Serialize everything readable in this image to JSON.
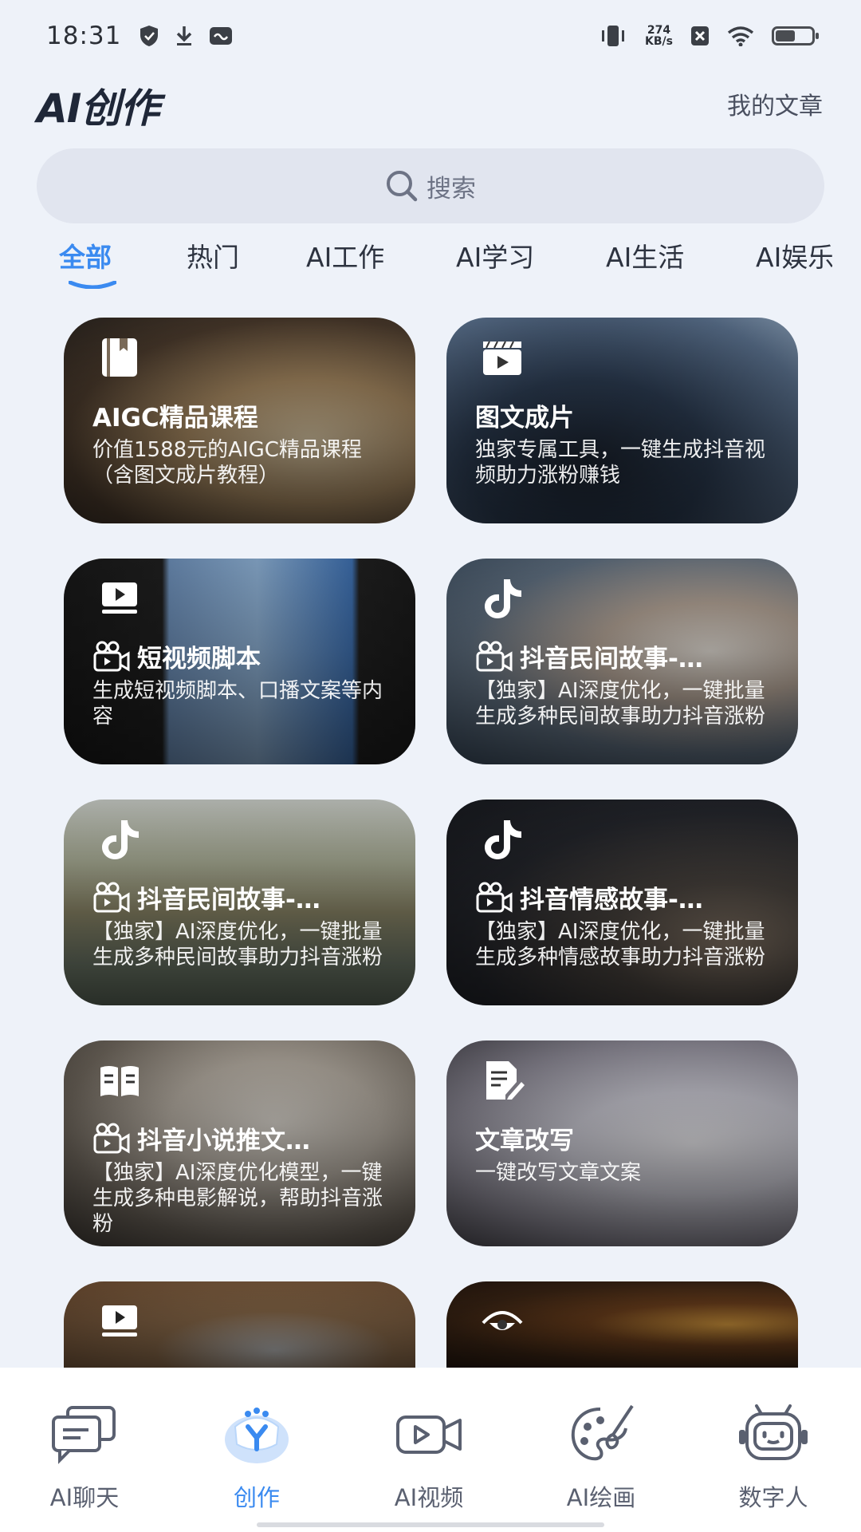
{
  "status_bar": {
    "time": "18:31",
    "net_speed_value": "274",
    "net_speed_unit": "KB/s",
    "battery_level_percent": 55,
    "icons": [
      "shield-icon",
      "download-icon",
      "chat-notify-icon",
      "vibrate-icon",
      "sim-off-icon",
      "wifi-icon",
      "battery-icon"
    ]
  },
  "header": {
    "title": "AI创作",
    "my_articles": "我的文章"
  },
  "search": {
    "placeholder": "搜索"
  },
  "tabs": [
    {
      "label": "全部",
      "active": true
    },
    {
      "label": "热门"
    },
    {
      "label": "AI工作"
    },
    {
      "label": "AI学习"
    },
    {
      "label": "AI生活"
    },
    {
      "label": "AI娱乐"
    }
  ],
  "cards": [
    {
      "icon": "book-icon",
      "title": "AIGC精品课程",
      "desc": "价值1588元的AIGC精品课程（含图文成片教程）",
      "show_video_icon": false
    },
    {
      "icon": "clapper-icon",
      "title": "图文成片",
      "desc": "独家专属工具，一键生成抖音视频助力涨粉赚钱",
      "show_video_icon": false
    },
    {
      "icon": "video-play-icon",
      "title": "短视频脚本",
      "desc": "生成短视频脚本、口播文案等内容",
      "show_video_icon": true
    },
    {
      "icon": "tiktok-icon",
      "title": "抖音民间故事-…",
      "desc": "【独家】AI深度优化，一键批量生成多种民间故事助力抖音涨粉",
      "show_video_icon": true
    },
    {
      "icon": "tiktok-icon",
      "title": "抖音民间故事-…",
      "desc": "【独家】AI深度优化，一键批量生成多种民间故事助力抖音涨粉",
      "show_video_icon": true
    },
    {
      "icon": "tiktok-icon",
      "title": "抖音情感故事-…",
      "desc": "【独家】AI深度优化，一键批量生成多种情感故事助力抖音涨粉",
      "show_video_icon": true
    },
    {
      "icon": "novel-icon",
      "title": "抖音小说推文…",
      "desc": "【独家】AI深度优化模型，一键生成多种电影解说，帮助抖音涨粉",
      "show_video_icon": true
    },
    {
      "icon": "edit-doc-icon",
      "title": "文章改写",
      "desc": "一键改写文章文案",
      "show_video_icon": false
    },
    {
      "icon": "video-play-icon",
      "title": "",
      "desc": "",
      "show_video_icon": false
    },
    {
      "icon": "eye-icon",
      "title": "",
      "desc": "",
      "show_video_icon": false
    }
  ],
  "bottom_nav": [
    {
      "label": "AI聊天",
      "icon": "chat-icon",
      "active": false
    },
    {
      "label": "创作",
      "icon": "create-icon",
      "active": true
    },
    {
      "label": "AI视频",
      "icon": "video-camera-icon",
      "active": false
    },
    {
      "label": "AI绘画",
      "icon": "palette-icon",
      "active": false
    },
    {
      "label": "数字人",
      "icon": "robot-icon",
      "active": false
    }
  ],
  "colors": {
    "accent": "#3a8af0",
    "background": "#eef2f9",
    "search_bg": "#e1e5ef"
  }
}
